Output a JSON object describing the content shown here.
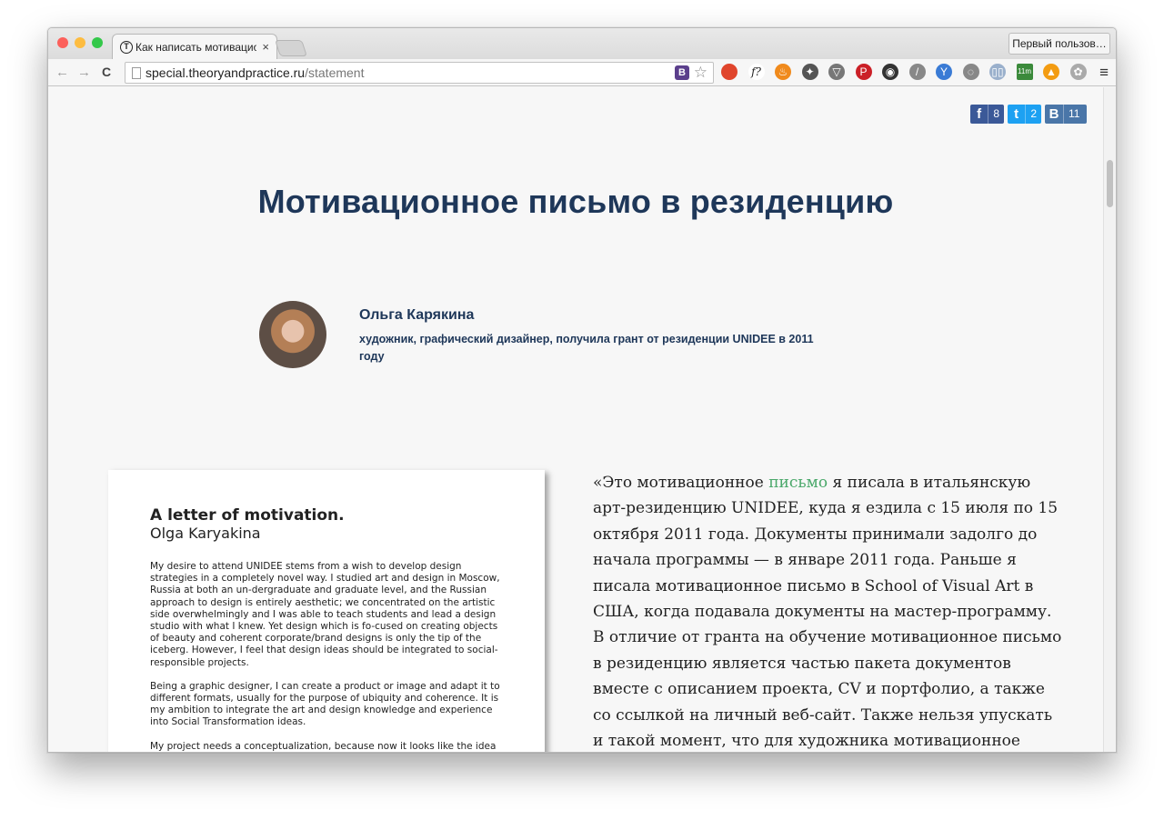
{
  "browser": {
    "tab_title": "Как написать мотивацион",
    "tab_close": "×",
    "tab_favicon": "T",
    "user_button": "Первый пользов…",
    "url_host": "special.theoryandpractice.ru",
    "url_path": "/statement",
    "back_icon": "←",
    "forward_icon": "→",
    "reload_icon": "C",
    "star_icon": "☆",
    "menu_icon": "≡",
    "omnibox_ext_label": "B",
    "extensions": [
      {
        "icon": "adblock-icon",
        "label": "",
        "color": "#e0452c"
      },
      {
        "icon": "function-icon",
        "label": "f?",
        "color": "#ffffff"
      },
      {
        "icon": "fire-icon",
        "label": "♨",
        "color": "#f08a1c"
      },
      {
        "icon": "evernote-icon",
        "label": "✦",
        "color": "#555555"
      },
      {
        "icon": "pocket-icon",
        "label": "▽",
        "color": "#777777"
      },
      {
        "icon": "pinterest-icon",
        "label": "P",
        "color": "#cb2027"
      },
      {
        "icon": "colorpicker-icon",
        "label": "◉",
        "color": "#333333"
      },
      {
        "icon": "eyedropper-icon",
        "label": "/",
        "color": "#888888"
      },
      {
        "icon": "yandex-icon",
        "label": "Y",
        "color": "#3a7bd5"
      },
      {
        "icon": "refresh-icon",
        "label": "◌",
        "color": "#888888"
      },
      {
        "icon": "reader-icon",
        "label": "▯▯",
        "color": "#9ab0cc"
      },
      {
        "icon": "timer-icon",
        "label": "11m",
        "color": "#3b8a3b"
      },
      {
        "icon": "chart-icon",
        "label": "▲",
        "color": "#f39c12"
      },
      {
        "icon": "paw-icon",
        "label": "✿",
        "color": "#aaaaaa"
      }
    ]
  },
  "share": {
    "facebook": {
      "icon": "f",
      "count": "8",
      "color": "#3b5998"
    },
    "twitter": {
      "icon": "t",
      "count": "2",
      "color": "#1da1f2"
    },
    "vk": {
      "icon": "В",
      "count": "11",
      "color": "#4a76a8"
    }
  },
  "page": {
    "title": "Мотивационное письмо в резиденцию",
    "author_name": "Ольга Карякина",
    "author_bio": "художник, графический дизайнер, получила грант от резиденции UNIDEE в 2011 году"
  },
  "letter": {
    "title": "A letter of motivation.",
    "name": "Olga Karyakina",
    "paragraphs": [
      "My desire to attend UNIDEE stems from a wish to develop design strategies in a completely novel way. I studied art and design in Moscow, Russia at both an un-dergraduate and graduate level, and the Russian approach to design is entirely aesthetic; we concentrated on the artistic side overwhelmingly and I was able to teach students and lead a design studio with what I knew. Yet design which is fo-cused on creating objects of beauty and coherent corporate/brand designs is only the tip of the iceberg. However, I feel that design ideas should be integrated to social-responsible projects.",
      "Being a graphic designer, I can create a product or image and adapt it to different formats, usually for the purpose of ubiquity and coherence. It is my ambition to integrate the art and design knowledge and experience into Social Transformation ideas.",
      "My project needs a conceptualization, because now it looks like the idea only. I have some local feedback from my friends, but it does not enough for project's"
    ]
  },
  "article": {
    "before": "«Это мотивационное ",
    "link": "письмо",
    "after": " я писала в итальянскую арт-резиденцию UNIDEE, куда я ездила с 15 июля по 15 октября 2011 года. Документы принимали задолго до начала программы — в январе 2011 года. Раньше я писала мотивационное письмо в School of Visual Art в США, когда подавала документы на мастер-программу. В отличие от гранта на обучение мотивационное письмо в резиденцию является частью пакета документов вместе с описанием проекта, CV и портфолио, а также со ссылкой на личный веб-сайт. Также нельзя упускать и такой момент, что для художника мотивационное письмо и портфолио имеют"
  }
}
